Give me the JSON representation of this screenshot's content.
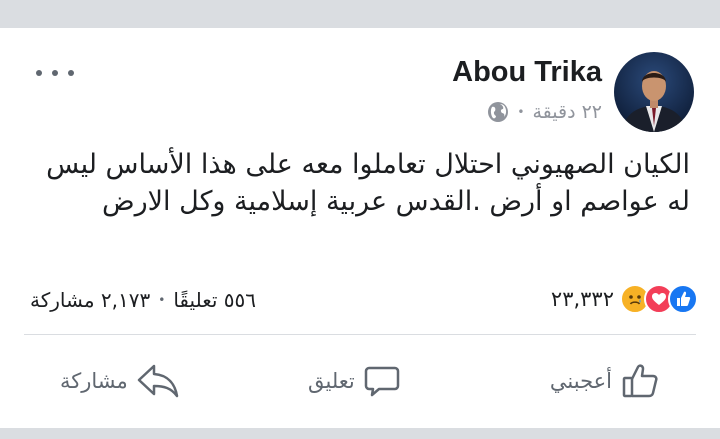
{
  "post": {
    "author": "Abou Trika",
    "time": "٢٢ دقيقة",
    "meta_separator": "•",
    "text": "الكيان الصهيوني احتلال تعاملوا معه على هذا الأساس ليس له عواصم او أرض .القدس عربية إسلامية وكل الارض",
    "privacy_icon": "globe-icon",
    "more_icon": "more-icon"
  },
  "reactions": {
    "icons": [
      "like-icon",
      "love-icon",
      "sad-icon"
    ],
    "count": "٢٣,٣٣٢"
  },
  "stats": {
    "comments": "٥٥٦ تعليقًا",
    "separator": "•",
    "shares": "٢,١٧٣ مشاركة"
  },
  "actions": {
    "like_label": "أعجبني",
    "comment_label": "تعليق",
    "share_label": "مشاركة"
  },
  "colors": {
    "like_blue": "#1877f2",
    "love_red": "#f33e58",
    "sad_yellow": "#f7b125",
    "secondary_text": "#606770",
    "meta_text": "#90949c"
  }
}
